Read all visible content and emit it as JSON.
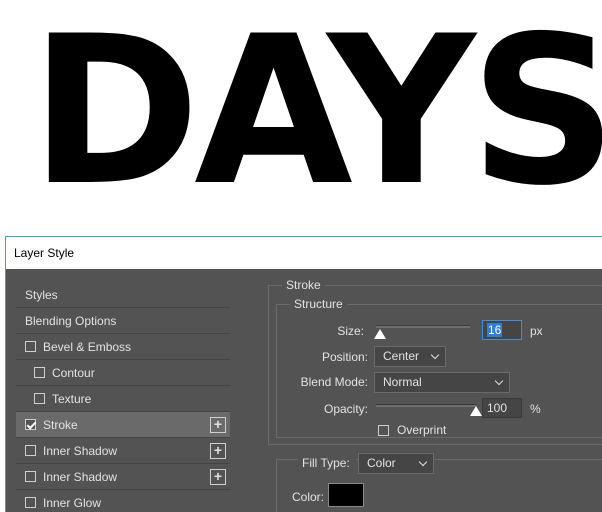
{
  "canvas": {
    "text": "DAYS"
  },
  "dialog": {
    "title": "Layer Style",
    "styles_list": [
      {
        "label": "Styles",
        "checkbox": false,
        "checked": false,
        "indent": false,
        "plus": false,
        "selected": false
      },
      {
        "label": "Blending Options",
        "checkbox": false,
        "checked": false,
        "indent": false,
        "plus": false,
        "selected": false
      },
      {
        "label": "Bevel & Emboss",
        "checkbox": true,
        "checked": false,
        "indent": false,
        "plus": false,
        "selected": false
      },
      {
        "label": "Contour",
        "checkbox": true,
        "checked": false,
        "indent": true,
        "plus": false,
        "selected": false
      },
      {
        "label": "Texture",
        "checkbox": true,
        "checked": false,
        "indent": true,
        "plus": false,
        "selected": false
      },
      {
        "label": "Stroke",
        "checkbox": true,
        "checked": true,
        "indent": false,
        "plus": true,
        "selected": true
      },
      {
        "label": "Inner Shadow",
        "checkbox": true,
        "checked": false,
        "indent": false,
        "plus": true,
        "selected": false
      },
      {
        "label": "Inner Shadow",
        "checkbox": true,
        "checked": false,
        "indent": false,
        "plus": true,
        "selected": false
      },
      {
        "label": "Inner Glow",
        "checkbox": true,
        "checked": false,
        "indent": false,
        "plus": false,
        "selected": false
      }
    ],
    "stroke": {
      "section_title": "Stroke",
      "structure_title": "Structure",
      "size_label": "Size:",
      "size_value": "16",
      "size_unit": "px",
      "size_slider_fraction": 0.04,
      "position_label": "Position:",
      "position_value": "Center",
      "blend_mode_label": "Blend Mode:",
      "blend_mode_value": "Normal",
      "opacity_label": "Opacity:",
      "opacity_value": "100",
      "opacity_unit": "%",
      "opacity_slider_fraction": 1.0,
      "overprint_label": "Overprint",
      "overprint_checked": false,
      "fill_type_label": "Fill Type:",
      "fill_type_value": "Color",
      "color_label": "Color:",
      "color_value": "#000000"
    },
    "colors": {
      "panel_bg": "#535353",
      "selected_row": "#6a6a6a",
      "accent_border": "#2aa9b8",
      "text_selection": "#2f7fd8"
    }
  }
}
